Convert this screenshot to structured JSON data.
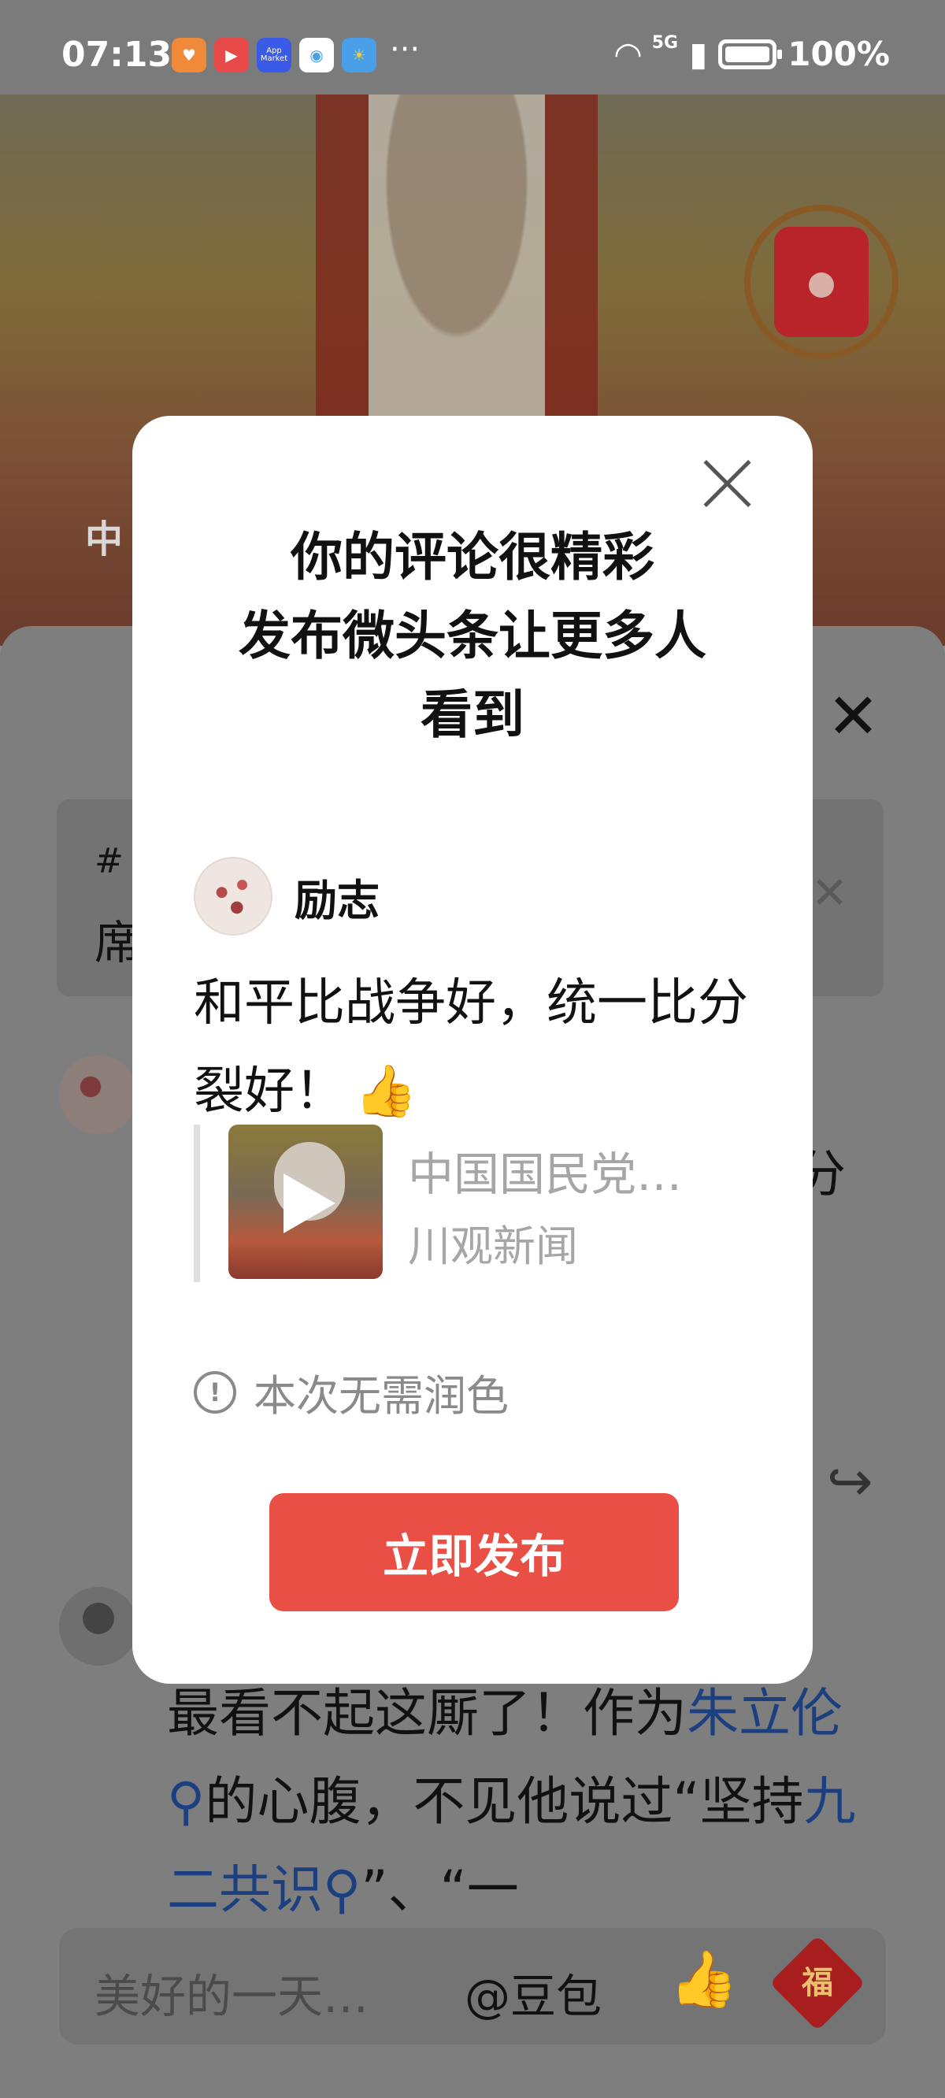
{
  "status_bar": {
    "time": "07:13",
    "apps": [
      {
        "name": "heart-app-icon",
        "color": "#f08a3a"
      },
      {
        "name": "video-app-icon",
        "color": "#e84a4a"
      },
      {
        "name": "app-market-icon",
        "color": "#3a5ae8",
        "label": "App Market"
      },
      {
        "name": "browser-app-icon",
        "color": "#4aa0e8"
      },
      {
        "name": "weather-app-icon",
        "color": "#f0b53a"
      }
    ],
    "more": "···",
    "network": "5G",
    "battery": "100%"
  },
  "video": {
    "caption": "中"
  },
  "comment_sheet": {
    "topic_text": "席",
    "background_comment_tail": "分",
    "second_comment": {
      "parts": [
        "最看不起这厮了！作为",
        "朱立伦",
        "的心腹，不见他说过“坚持",
        "九二共识",
        "”、“一"
      ]
    }
  },
  "bottom_bar": {
    "placeholder": "美好的一天…",
    "mention": "@豆包",
    "fu": "福"
  },
  "modal": {
    "title_lines": [
      "你的评论很精彩",
      "发布微头条让更多人",
      "看到"
    ],
    "author_name": "励志",
    "comment": "和平比战争好，统一比分裂好！",
    "emoji": "👍",
    "quote_title": "中国国民党…",
    "quote_source": "川观新闻",
    "polish_notice": "本次无需润色",
    "publish_label": "立即发布"
  }
}
